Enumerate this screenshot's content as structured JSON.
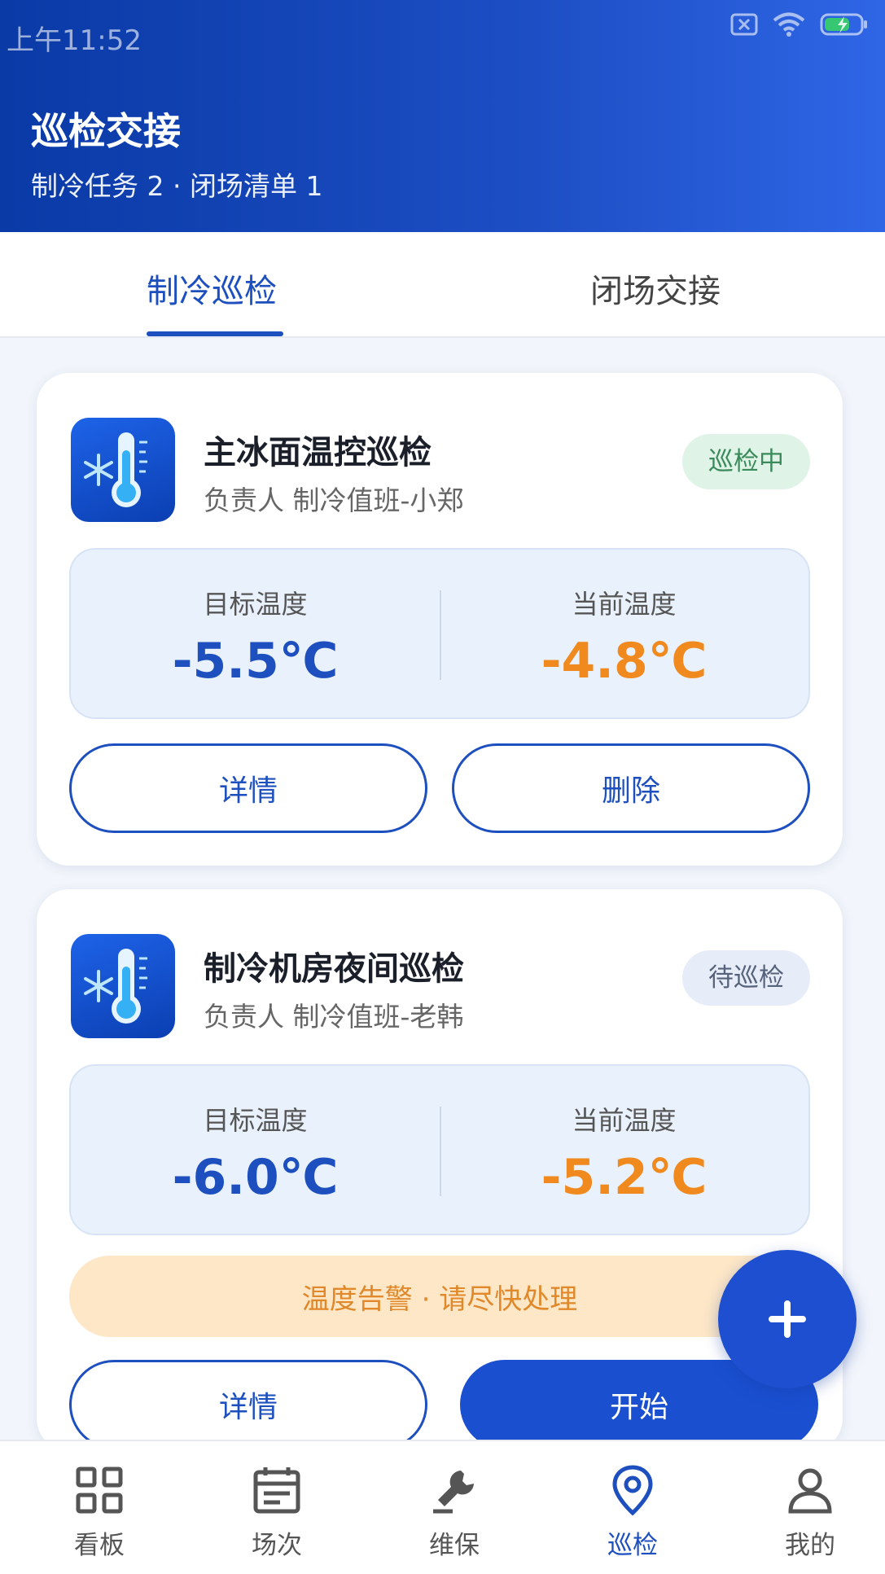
{
  "status_bar": {
    "time": "上午11:52"
  },
  "header": {
    "title": "巡检交接",
    "subtitle": "制冷任务 2 · 闭场清单 1"
  },
  "tabs": [
    {
      "label": "制冷巡检",
      "active": true
    },
    {
      "label": "闭场交接",
      "active": false
    }
  ],
  "tasks": [
    {
      "title": "主冰面温控巡检",
      "owner": "负责人 制冷值班-小郑",
      "status": "巡检中",
      "target_label": "目标温度",
      "target_value": "-5.5℃",
      "current_label": "当前温度",
      "current_value": "-4.8℃",
      "btn_left": "详情",
      "btn_right": "删除"
    },
    {
      "title": "制冷机房夜间巡检",
      "owner": "负责人 制冷值班-老韩",
      "status": "待巡检",
      "target_label": "目标温度",
      "target_value": "-6.0℃",
      "current_label": "当前温度",
      "current_value": "-5.2℃",
      "alert": "温度告警 · 请尽快处理",
      "btn_left": "详情",
      "btn_right": "开始"
    }
  ],
  "fab": {
    "icon": "plus-icon",
    "label": "+"
  },
  "bottom_nav": [
    {
      "label": "看板",
      "icon": "grid-icon"
    },
    {
      "label": "场次",
      "icon": "calendar-icon"
    },
    {
      "label": "维保",
      "icon": "wrench-icon"
    },
    {
      "label": "巡检",
      "icon": "location-pin-icon",
      "active": true
    },
    {
      "label": "我的",
      "icon": "user-icon"
    }
  ],
  "colors": {
    "primary": "#1d4fbf",
    "header_gradient_start": "#0a3aa6",
    "header_gradient_end": "#2f66e6",
    "current_temp": "#f08a1f",
    "alert_bg": "#fde7c7",
    "badge_active_bg": "#dff3e7"
  }
}
